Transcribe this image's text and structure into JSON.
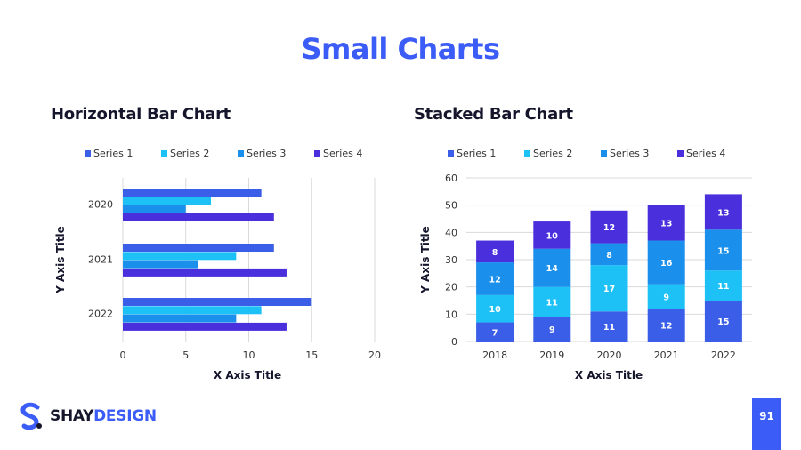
{
  "page": {
    "title": "Small Charts",
    "brand": {
      "part1": "SHAY",
      "part2": "DESIGN"
    },
    "page_number": "91"
  },
  "colors": {
    "accent": "#3b5cf6",
    "series": [
      "#3b5ee8",
      "#1ec1f5",
      "#1a8fec",
      "#4a2fdc"
    ]
  },
  "chart_data": [
    {
      "type": "bar",
      "orientation": "horizontal",
      "title": "Horizontal Bar Chart",
      "xlabel": "X Axis Title",
      "ylabel": "Y Axis Title",
      "categories": [
        "2020",
        "2021",
        "2022"
      ],
      "xlim": [
        0,
        20
      ],
      "xticks": [
        "0",
        "5",
        "10",
        "15",
        "20"
      ],
      "legend_position": "top",
      "grid": true,
      "series": [
        {
          "name": "Series 1",
          "values": [
            11,
            12,
            15
          ]
        },
        {
          "name": "Series 2",
          "values": [
            7,
            9,
            11
          ]
        },
        {
          "name": "Series 3",
          "values": [
            5,
            6,
            9
          ]
        },
        {
          "name": "Series 4",
          "values": [
            12,
            13,
            13
          ]
        }
      ]
    },
    {
      "type": "bar",
      "stacked": true,
      "title": "Stacked Bar Chart",
      "xlabel": "X Axis Title",
      "ylabel": "Y Axis Title",
      "categories": [
        "2018",
        "2019",
        "2020",
        "2021",
        "2022"
      ],
      "ylim": [
        0,
        60
      ],
      "yticks": [
        "0",
        "10",
        "20",
        "30",
        "40",
        "50",
        "60"
      ],
      "legend_position": "top",
      "grid": true,
      "data_labels": true,
      "series": [
        {
          "name": "Series 1",
          "values": [
            7,
            9,
            11,
            12,
            15
          ]
        },
        {
          "name": "Series 2",
          "values": [
            10,
            11,
            17,
            9,
            11
          ]
        },
        {
          "name": "Series 3",
          "values": [
            12,
            14,
            8,
            16,
            15
          ]
        },
        {
          "name": "Series 4",
          "values": [
            8,
            10,
            12,
            13,
            13
          ]
        }
      ]
    }
  ]
}
